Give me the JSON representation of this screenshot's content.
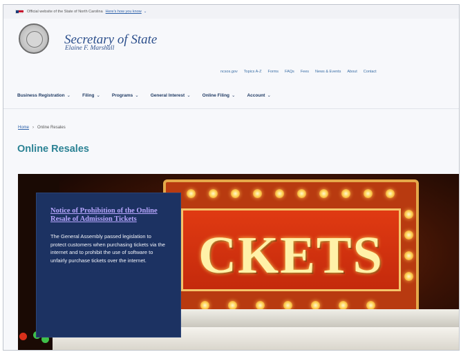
{
  "gov_banner": {
    "text": "Official website of the State of North Carolina",
    "link_label": "Here's how you know"
  },
  "header": {
    "title": "Secretary of State",
    "subtitle": "Elaine F. Marshall"
  },
  "utility_nav": [
    "ncsos.gov",
    "Topics A-Z",
    "Forms",
    "FAQs",
    "Fees",
    "News & Events",
    "About",
    "Contact"
  ],
  "main_nav": [
    {
      "label": "Business Registration"
    },
    {
      "label": "Filing"
    },
    {
      "label": "Programs"
    },
    {
      "label": "General Interest"
    },
    {
      "label": "Online Filing"
    },
    {
      "label": "Account"
    }
  ],
  "breadcrumb": {
    "home": "Home",
    "separator": "›",
    "current": "Online Resales"
  },
  "page_title": "Online Resales",
  "hero": {
    "image_text": "CKETS",
    "card_title": "Notice of Prohibition of the Online Resale of Admission Tickets",
    "card_body": "The General Assembly passed legislation to protect customers when purchasing tickets via the internet and to prohibit the use of software to unfairly purchase tickets over the internet."
  },
  "colors": {
    "title_teal": "#2b8294",
    "brand_blue": "#2c4f8c",
    "card_navy": "#1c3262",
    "card_link": "#b7a6ff"
  }
}
